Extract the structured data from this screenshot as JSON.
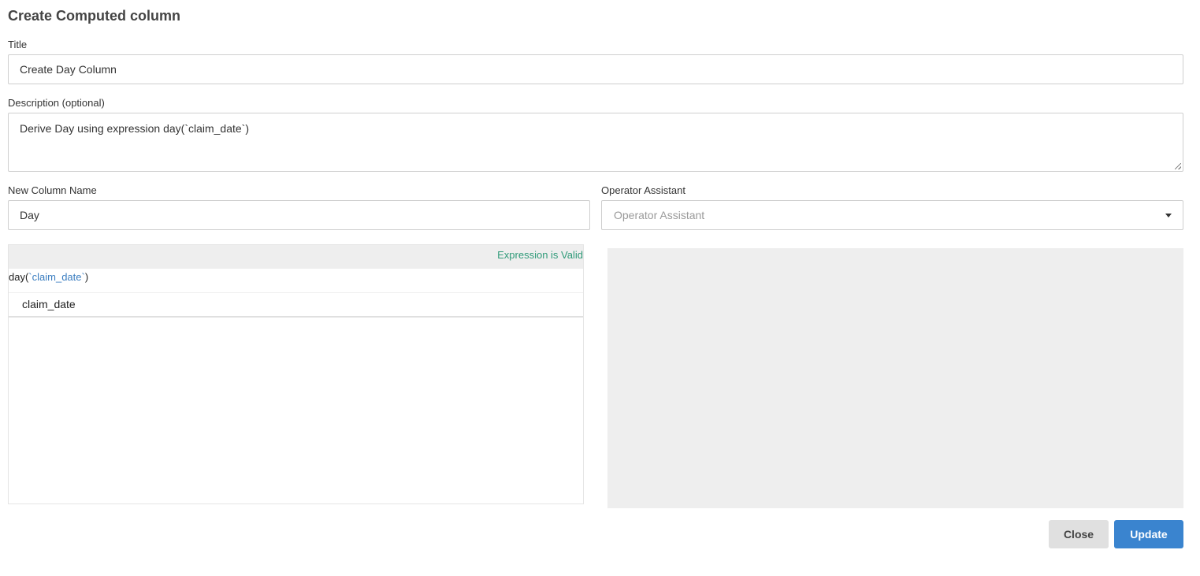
{
  "dialog": {
    "title": "Create Computed column"
  },
  "title_field": {
    "label": "Title",
    "value": "Create Day Column"
  },
  "description_field": {
    "label": "Description (optional)",
    "value": "Derive Day using expression day(`claim_date`)"
  },
  "column_name_field": {
    "label": "New Column Name",
    "value": "Day"
  },
  "operator_assistant": {
    "label": "Operator Assistant",
    "placeholder": "Operator Assistant"
  },
  "editor": {
    "status": "Expression is Valid",
    "expr_prefix": "day(",
    "expr_arg": "`claim_date`",
    "expr_suffix": ")",
    "suggestions": [
      "claim_date"
    ]
  },
  "buttons": {
    "close": "Close",
    "update": "Update"
  },
  "colors": {
    "valid": "#2e9a78",
    "primary": "#3a84cf",
    "panel": "#eeeeee"
  }
}
